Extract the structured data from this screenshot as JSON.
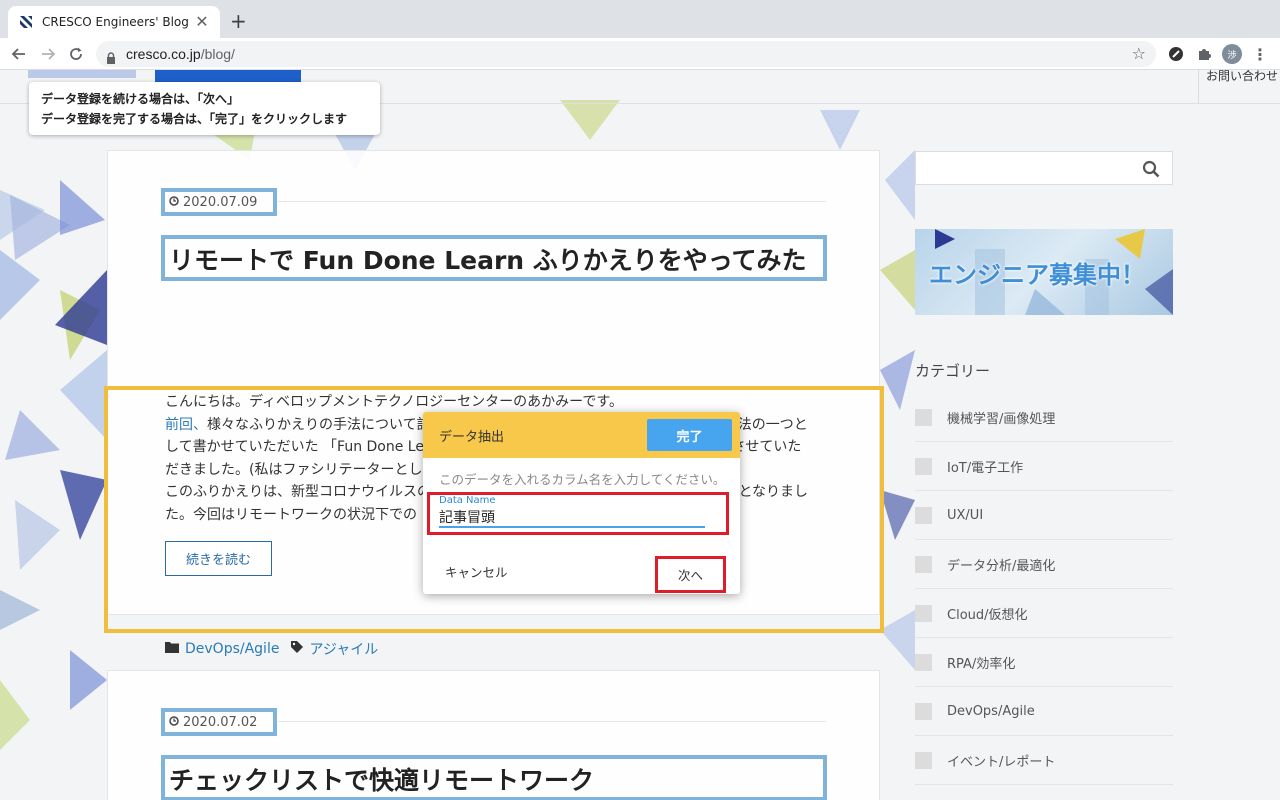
{
  "browser": {
    "tab_title": "CRESCO Engineers' Blog",
    "new_tab_label": "+",
    "tab_close_label": "✕",
    "url_host": "cresco.co.jp",
    "url_path": "/blog/",
    "avatar_initial": "渉"
  },
  "header": {
    "contact_label": "お問い合わせ"
  },
  "tooltip": {
    "line1": "データ登録を続ける場合は、「次へ」",
    "line2": "データ登録を完了する場合は、「完了」をクリックします"
  },
  "posts": [
    {
      "date": "2020.07.09",
      "title": "リモートで Fun Done Learn ふりかえりをやってみた",
      "excerpt_lines": [
        "こんにちは。ディベロップメントテクノロジーセンターのあかみーです。",
        "様々なふりかえりの手法について記事を書かせていただきました。そしてそちらに手法の一つと",
        "して書かせていただいた 「Fun Done Learn」 を用いたふりかえりを、とある案件で実施させていた",
        "だきました。(私はファシリテーターとして参加させていただきました。)",
        "このふりかえりは、新型コロナウイルスの影響で、メンバー全員がリモートワークでの開催となりまし",
        "た。今回はリモートワークの状況下での"
      ],
      "excerpt_link": "前回、",
      "read_more": "続きを読む",
      "category_tag": "DevOps/Agile",
      "tag": "アジャイル"
    },
    {
      "date": "2020.07.02",
      "title": "チェックリストで快適リモートワーク"
    }
  ],
  "sidebar": {
    "banner_text": "エンジニア募集中！",
    "categories_heading": "カテゴリー",
    "categories": [
      "機械学習/画像処理",
      "IoT/電子工作",
      "UX/UI",
      "データ分析/最適化",
      "Cloud/仮想化",
      "RPA/効率化",
      "DevOps/Agile",
      "イベント/レポート"
    ]
  },
  "modal": {
    "title": "データ抽出",
    "done_label": "完了",
    "hint": "このデータを入れるカラム名を入力してください。",
    "field_label": "Data Name",
    "field_value": "記事冒頭",
    "cancel_label": "キャンセル",
    "next_label": "次へ"
  },
  "colors": {
    "accent_blue": "#47a5ef",
    "modal_header": "#f7c84a",
    "highlight_red": "#e01b2a",
    "highlight_yellow": "#f0bd3c",
    "highlight_blue": "#7fb3dc"
  }
}
